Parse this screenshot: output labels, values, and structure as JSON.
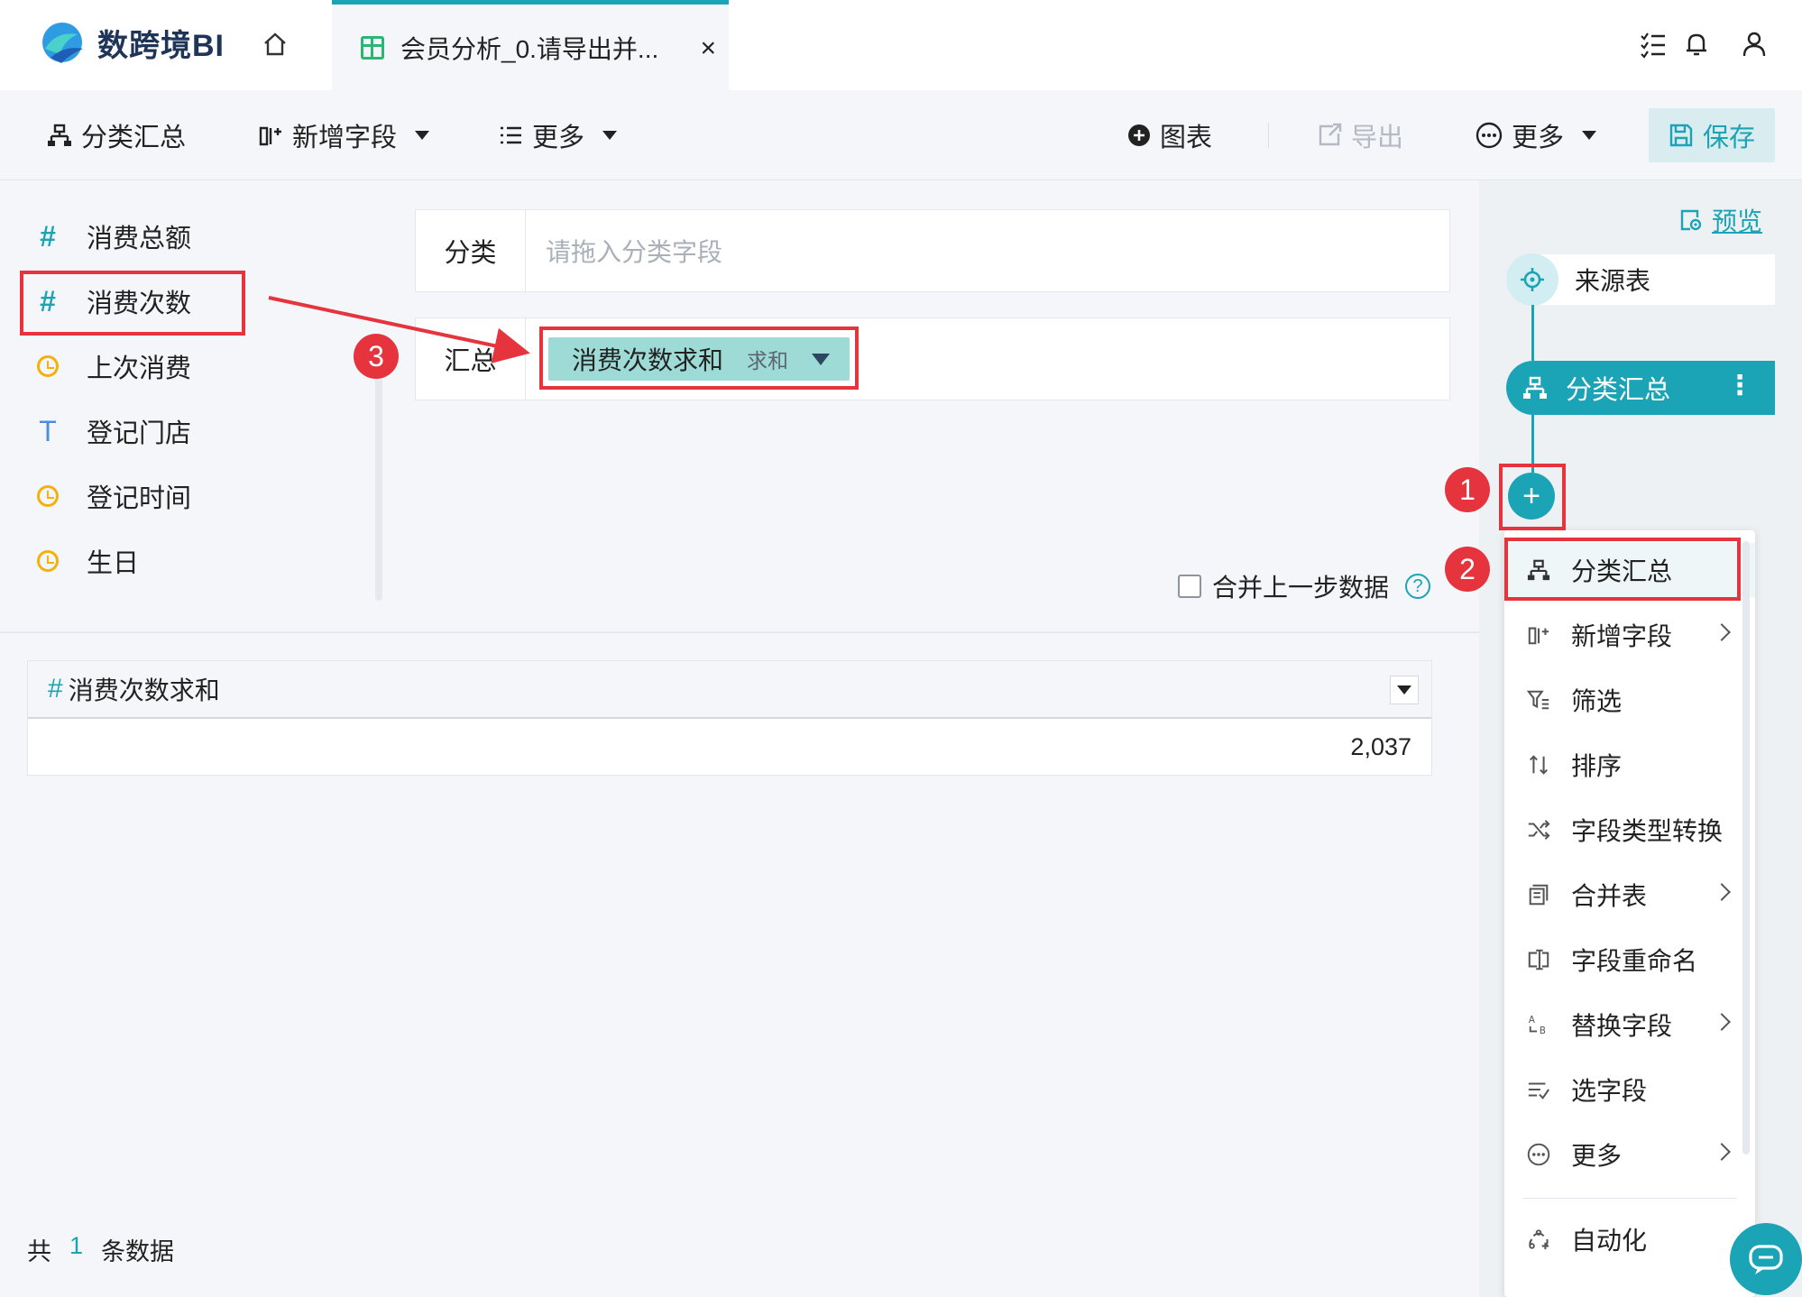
{
  "app": {
    "brand": "数跨境BI",
    "tab_title": "会员分析_0.请导出并...",
    "tab_close": "×"
  },
  "toolbar": {
    "group_summary": "分类汇总",
    "add_field": "新增字段",
    "more_left": "更多",
    "chart": "图表",
    "export": "导出",
    "more_right": "更多",
    "save": "保存"
  },
  "fields": [
    {
      "icon": "hash-icon",
      "label": "消费总额"
    },
    {
      "icon": "hash-icon",
      "label": "消费次数"
    },
    {
      "icon": "clock-icon",
      "label": "上次消费"
    },
    {
      "icon": "text-icon",
      "label": "登记门店"
    },
    {
      "icon": "clock-icon",
      "label": "登记时间"
    },
    {
      "icon": "clock-icon",
      "label": "生日"
    }
  ],
  "config": {
    "group_label": "分类",
    "group_placeholder": "请拖入分类字段",
    "summary_label": "汇总",
    "chip_label": "消费次数求和",
    "chip_agg": "求和",
    "merge_label": "合并上一步数据",
    "help": "?"
  },
  "table": {
    "column": "消费次数求和",
    "rows": [
      "2,037"
    ]
  },
  "footer": {
    "prefix": "共",
    "count": "1",
    "suffix": "条数据"
  },
  "flow": {
    "preview": "预览",
    "source_node": "来源表",
    "active_node": "分类汇总",
    "add": "+"
  },
  "menu": {
    "items": [
      {
        "label": "分类汇总",
        "icon": "group-icon",
        "submenu": false
      },
      {
        "label": "新增字段",
        "icon": "add-field-icon",
        "submenu": true
      },
      {
        "label": "筛选",
        "icon": "filter-icon",
        "submenu": false
      },
      {
        "label": "排序",
        "icon": "sort-icon",
        "submenu": false
      },
      {
        "label": "字段类型转换",
        "icon": "shuffle-icon",
        "submenu": false
      },
      {
        "label": "合并表",
        "icon": "merge-table-icon",
        "submenu": true
      },
      {
        "label": "字段重命名",
        "icon": "rename-icon",
        "submenu": false
      },
      {
        "label": "替换字段",
        "icon": "replace-icon",
        "submenu": true
      },
      {
        "label": "选字段",
        "icon": "select-field-icon",
        "submenu": false
      },
      {
        "label": "更多",
        "icon": "more-circle-icon",
        "submenu": true
      },
      {
        "label": "自动化",
        "icon": "automation-icon",
        "submenu": false
      }
    ]
  },
  "annotations": {
    "badge1": "1",
    "badge2": "2",
    "badge3": "3"
  },
  "colors": {
    "accent": "#1ba4b5",
    "highlight_red": "#e5343d",
    "chip": "#9edbd6"
  }
}
